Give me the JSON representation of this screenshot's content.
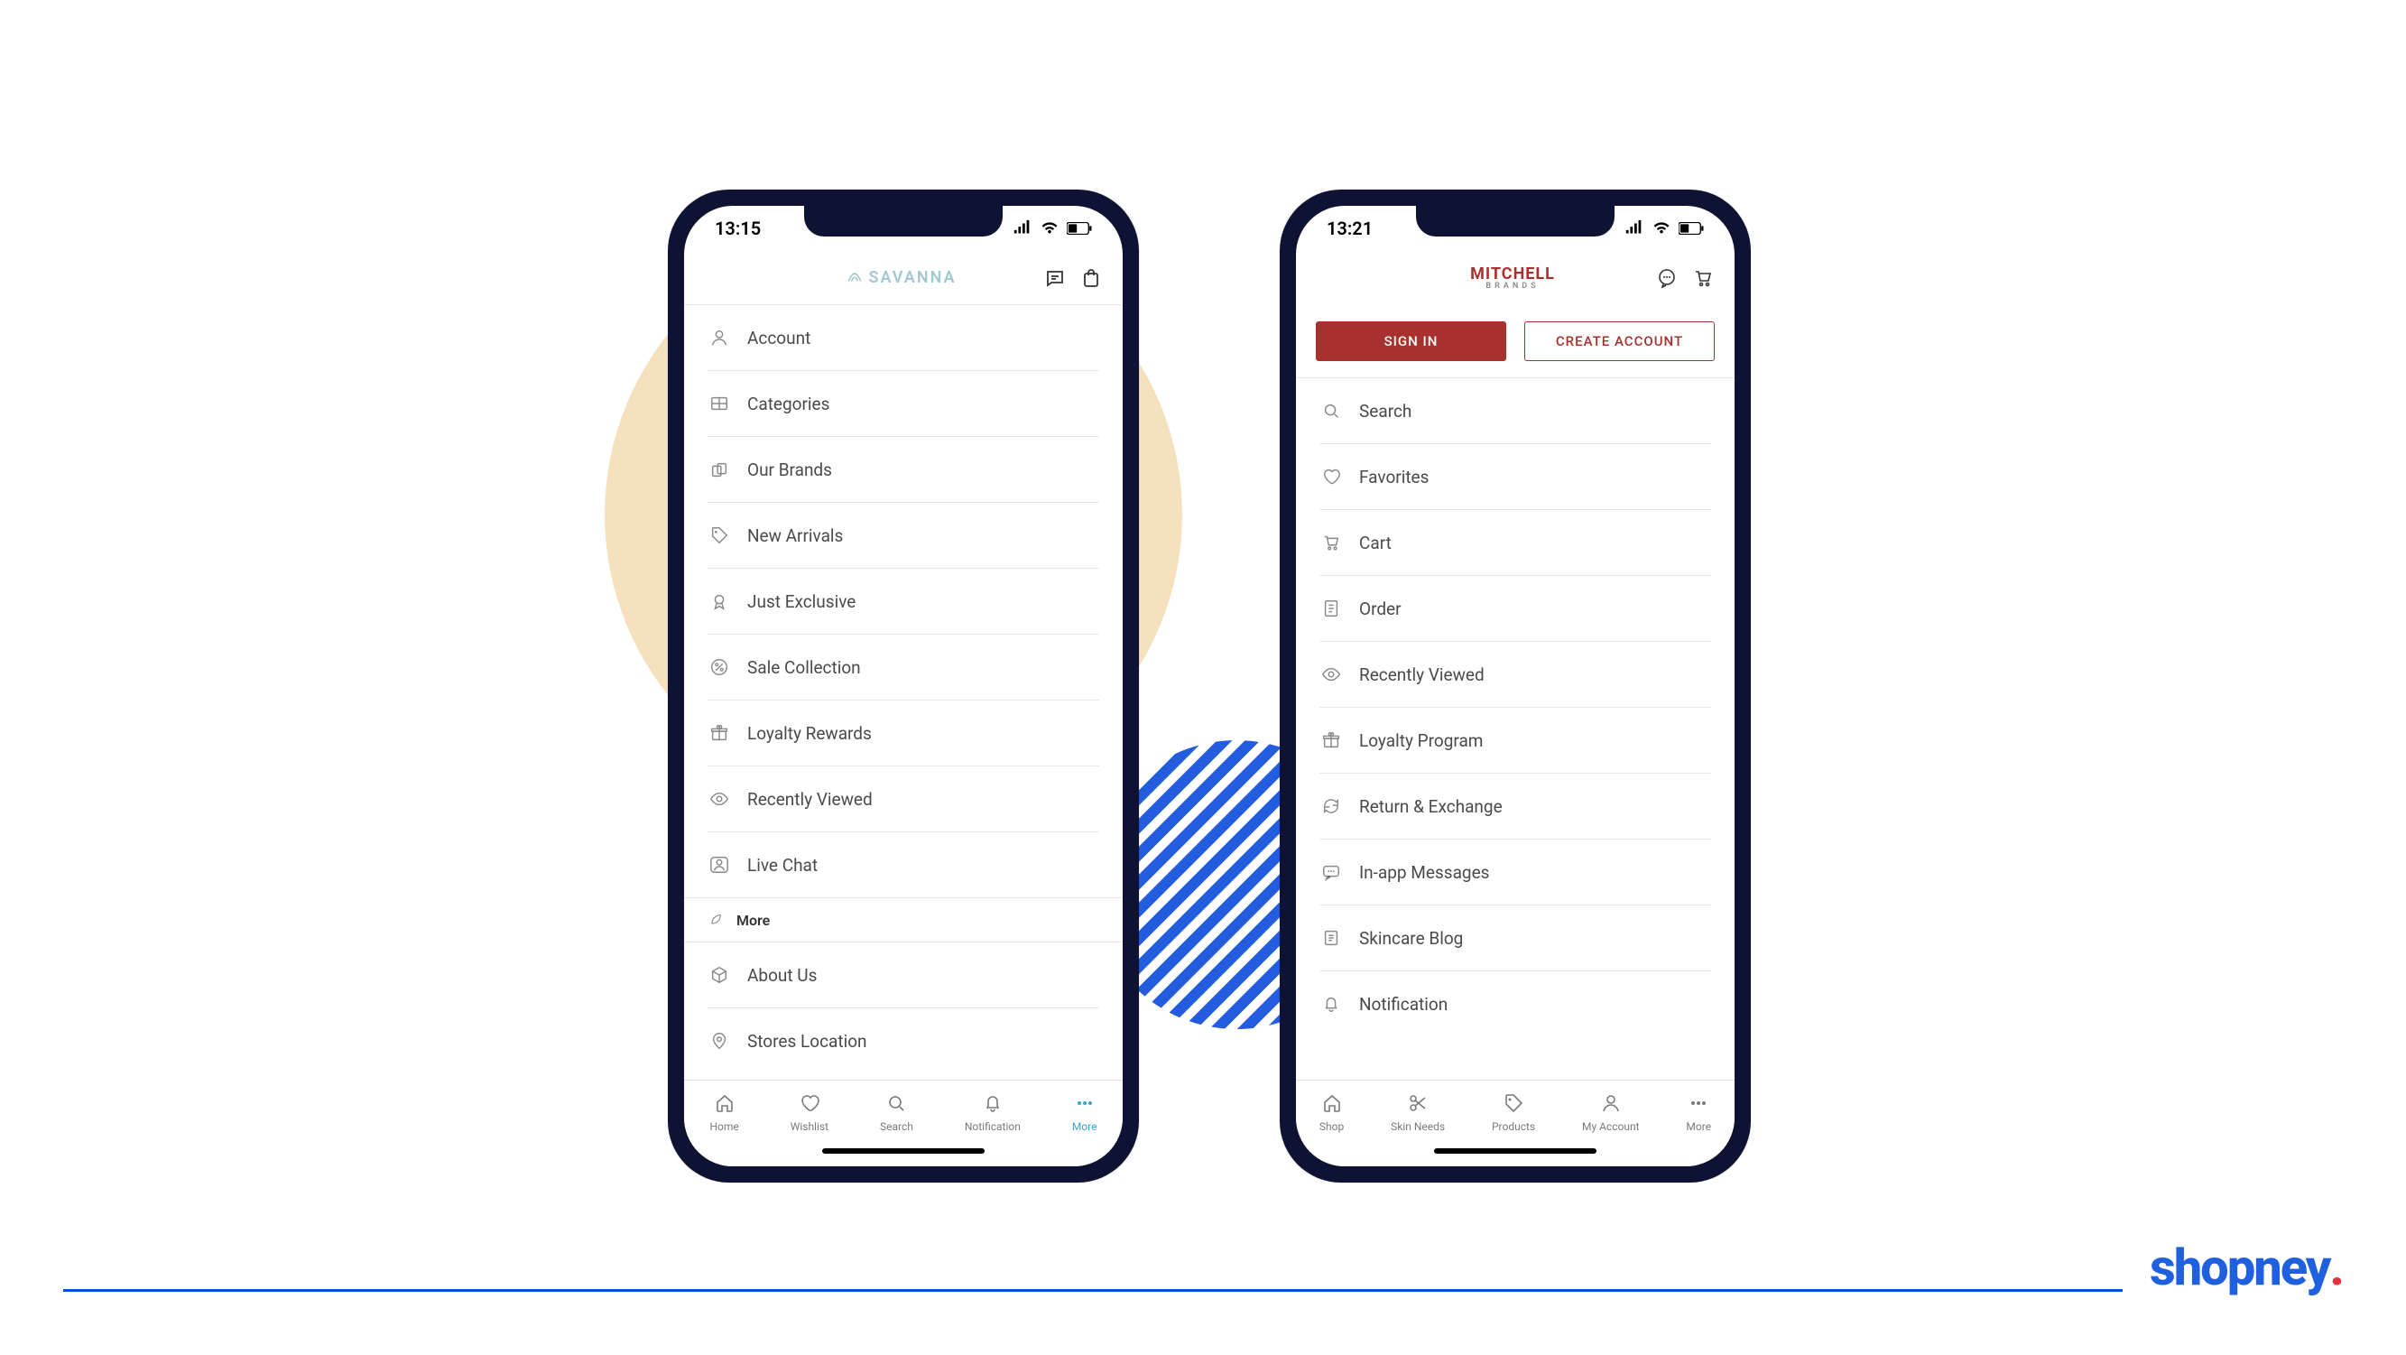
{
  "phone_left": {
    "time": "13:15",
    "brand": "SAVANNA",
    "menu": [
      {
        "icon": "user",
        "label": "Account"
      },
      {
        "icon": "grid",
        "label": "Categories"
      },
      {
        "icon": "bag-multi",
        "label": "Our Brands"
      },
      {
        "icon": "tag",
        "label": "New Arrivals"
      },
      {
        "icon": "rosette",
        "label": "Just Exclusive"
      },
      {
        "icon": "percent",
        "label": "Sale Collection"
      },
      {
        "icon": "gift",
        "label": "Loyalty Rewards"
      },
      {
        "icon": "eye",
        "label": "Recently Viewed"
      },
      {
        "icon": "chat-user",
        "label": "Live Chat"
      }
    ],
    "section_label": "More",
    "more_menu": [
      {
        "icon": "cube",
        "label": "About Us"
      },
      {
        "icon": "pin",
        "label": "Stores Location"
      }
    ],
    "tabs": [
      {
        "icon": "home",
        "label": "Home",
        "active": false
      },
      {
        "icon": "heart",
        "label": "Wishlist",
        "active": false
      },
      {
        "icon": "search",
        "label": "Search",
        "active": false
      },
      {
        "icon": "bell",
        "label": "Notification",
        "active": false
      },
      {
        "icon": "dots",
        "label": "More",
        "active": true
      }
    ]
  },
  "phone_right": {
    "time": "13:21",
    "brand_main": "MITCHELL",
    "brand_sub": "BRANDS",
    "sign_in": "SIGN IN",
    "create_account": "CREATE ACCOUNT",
    "menu": [
      {
        "icon": "search",
        "label": "Search"
      },
      {
        "icon": "heart",
        "label": "Favorites"
      },
      {
        "icon": "cart",
        "label": "Cart"
      },
      {
        "icon": "receipt",
        "label": "Order"
      },
      {
        "icon": "eye",
        "label": "Recently Viewed"
      },
      {
        "icon": "gift",
        "label": "Loyalty Program"
      },
      {
        "icon": "refresh",
        "label": "Return & Exchange"
      },
      {
        "icon": "chat",
        "label": "In-app Messages"
      },
      {
        "icon": "doc",
        "label": "Skincare Blog"
      },
      {
        "icon": "bell",
        "label": "Notification"
      }
    ],
    "tabs": [
      {
        "icon": "home",
        "label": "Shop",
        "active": false
      },
      {
        "icon": "scissors",
        "label": "Skin Needs",
        "active": false
      },
      {
        "icon": "tag",
        "label": "Products",
        "active": false
      },
      {
        "icon": "user",
        "label": "My Account",
        "active": false
      },
      {
        "icon": "dots",
        "label": "More",
        "active": false
      }
    ]
  },
  "footer_brand": "shopney"
}
